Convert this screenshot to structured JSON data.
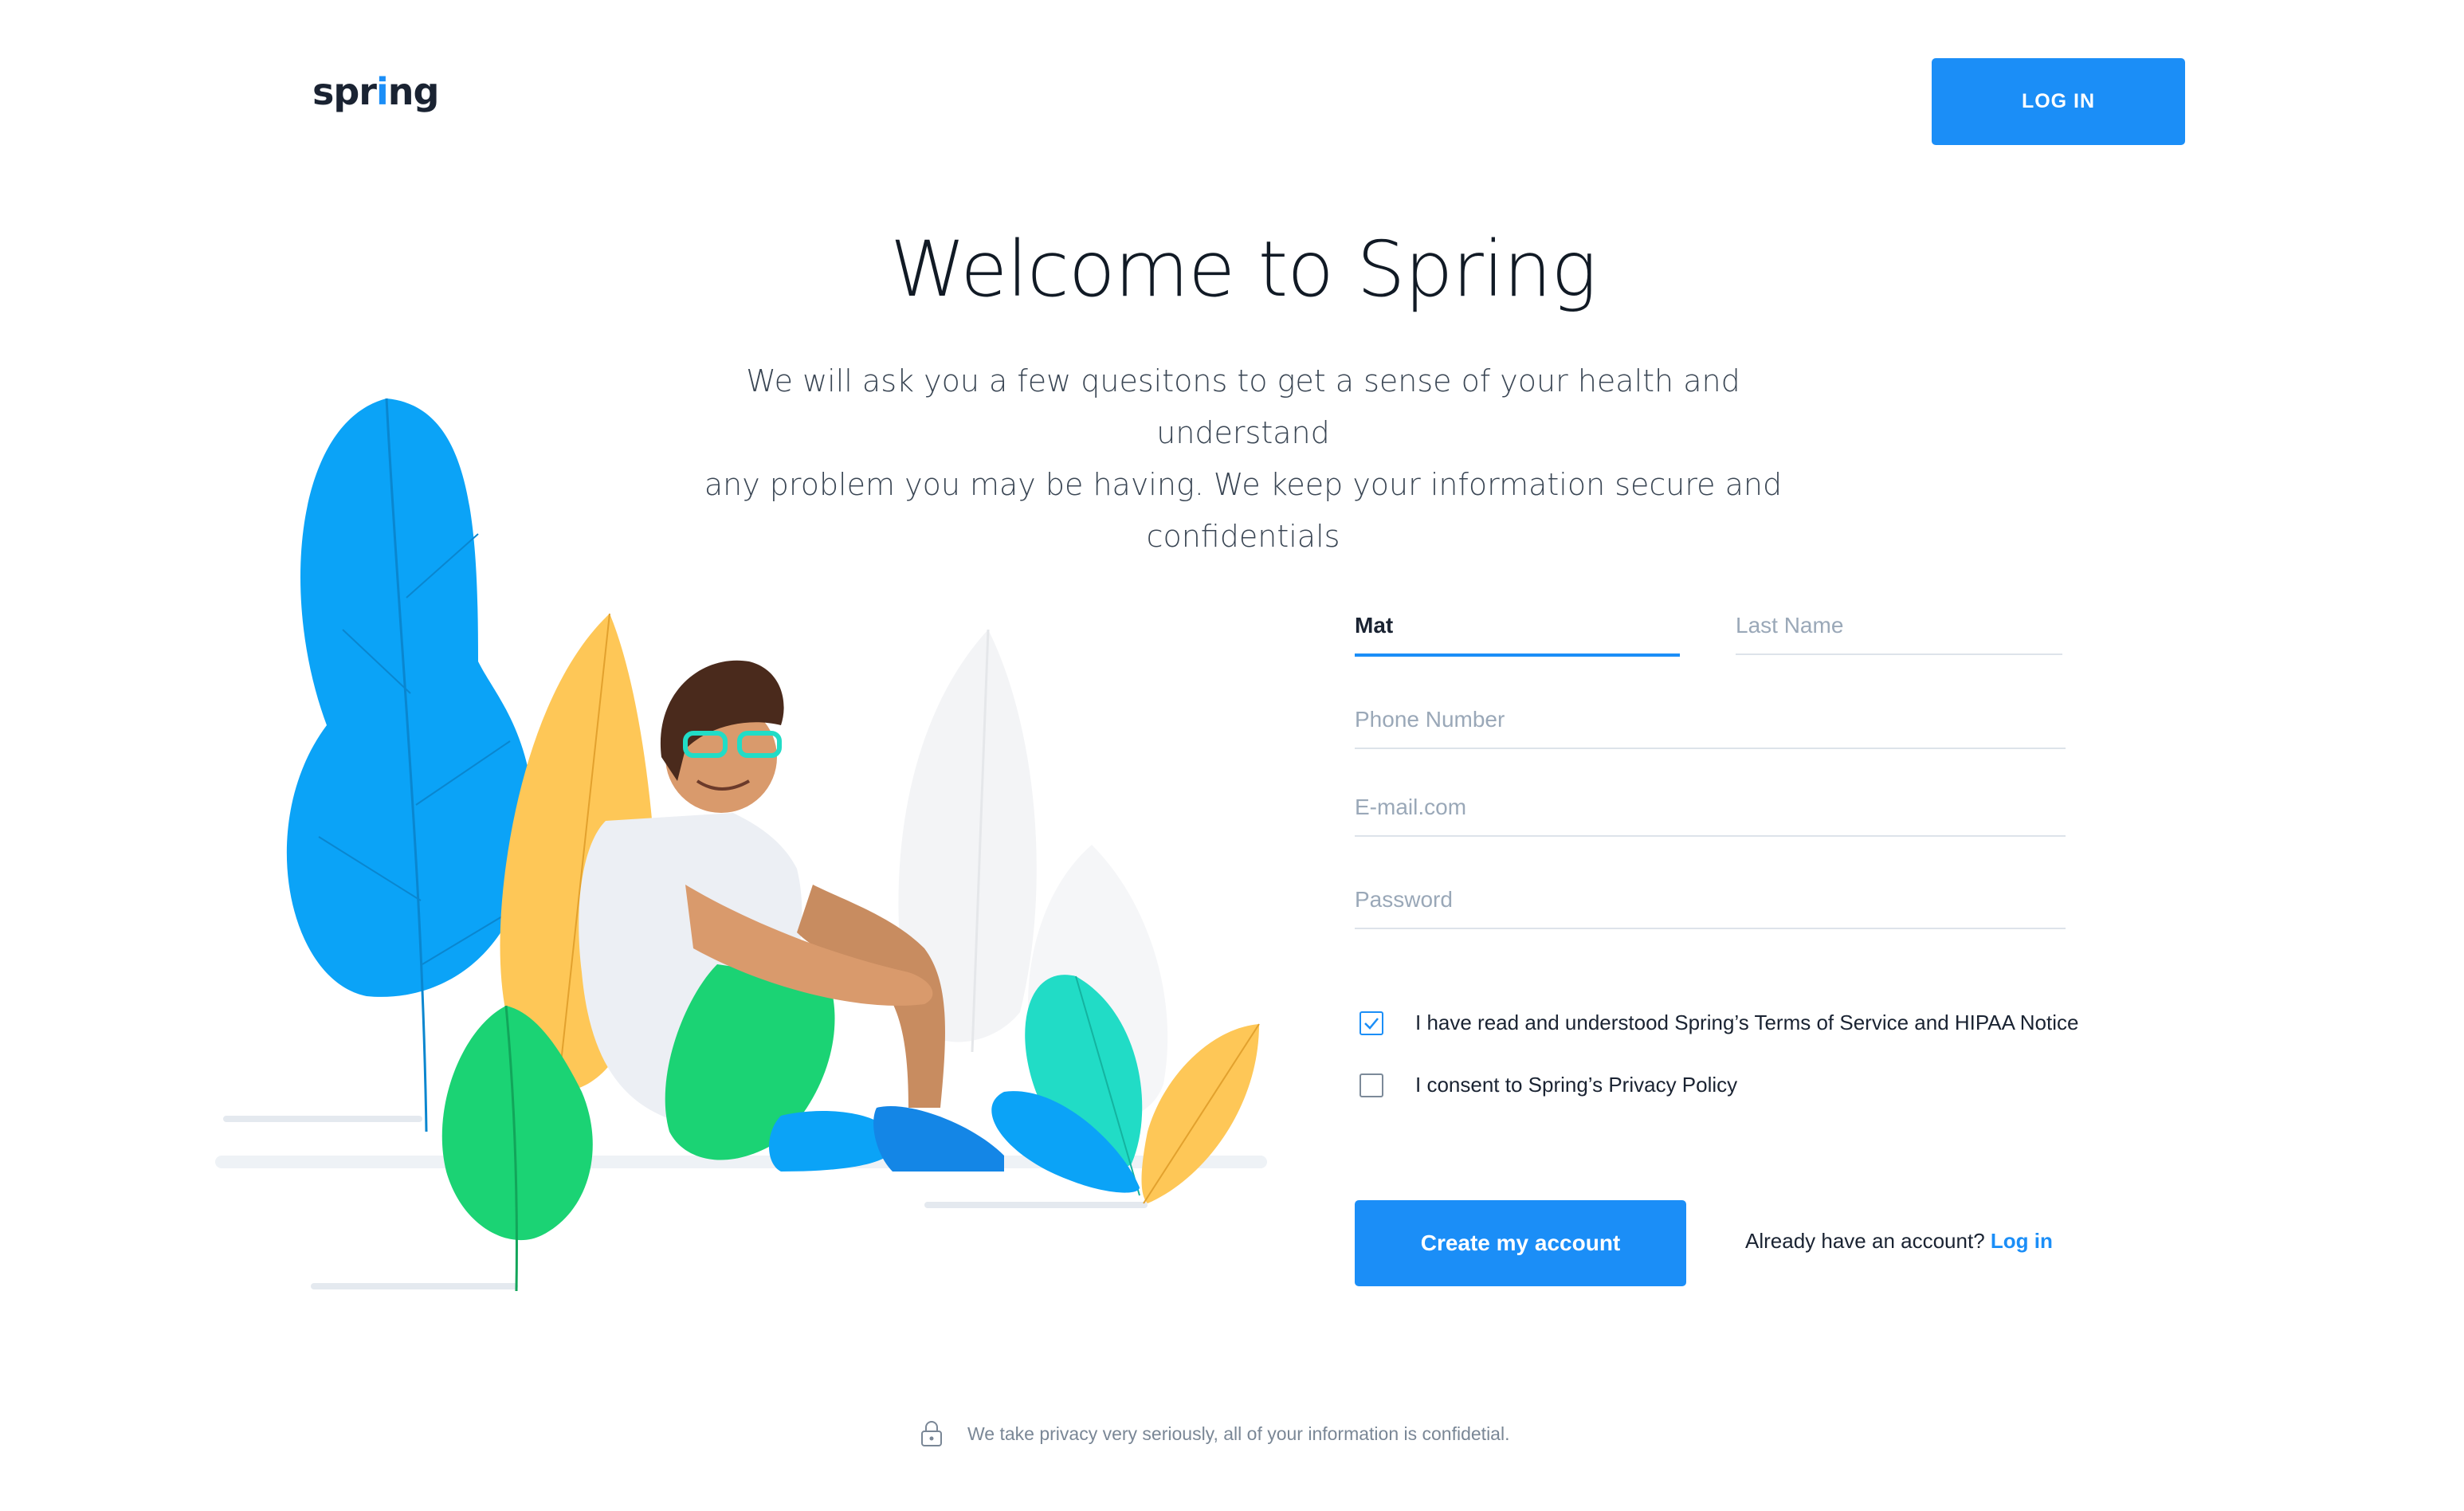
{
  "header": {
    "logo_text_pre": "spr",
    "logo_text_dot": "i",
    "logo_text_post": "ng",
    "login_label": "LOG IN"
  },
  "hero": {
    "title": "Welcome to Spring",
    "subtitle_line1": "We will ask you a few quesitons to get a sense of your health and understand",
    "subtitle_line2": "any problem you may be having. We keep your information secure and",
    "subtitle_line3": "confidentials"
  },
  "form": {
    "first_name_value": "Mat",
    "last_name_placeholder": "Last Name",
    "phone_placeholder": "Phone Number",
    "email_placeholder": "E-mail.com",
    "password_placeholder": "Password",
    "terms_label": "I have read and understood Spring’s Terms of Service and HIPAA Notice",
    "terms_checked": true,
    "privacy_label": "I consent to Spring’s Privacy Policy",
    "privacy_checked": false,
    "create_label": "Create my account",
    "already_text": "Already have an account?",
    "login_link": "Log in"
  },
  "footer": {
    "privacy_note": "We take privacy very seriously, all of your information is confidetial."
  },
  "colors": {
    "accent": "#1b8ef7",
    "text": "#1a2332",
    "muted": "#9aa8b8"
  }
}
